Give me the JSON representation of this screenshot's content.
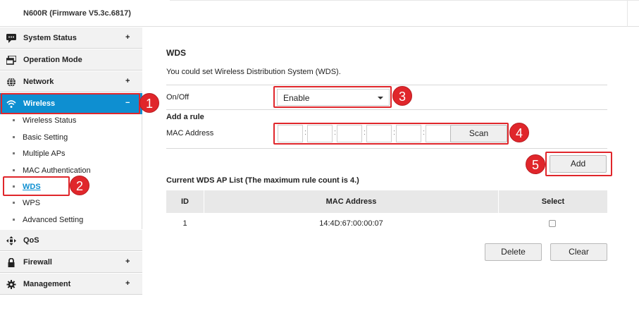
{
  "window": {
    "model_title": "N600R (Firmware V5.3c.6817)"
  },
  "sidebar": {
    "menu": [
      {
        "label": "System Status",
        "icon": "chat-bubble-icon",
        "toggle": "+"
      },
      {
        "label": "Operation Mode",
        "icon": "window-icon",
        "toggle": ""
      },
      {
        "label": "Network",
        "icon": "globe-icon",
        "toggle": "+"
      },
      {
        "label": "Wireless",
        "icon": "wifi-icon",
        "toggle": "−"
      },
      {
        "label": "QoS",
        "icon": "qos-icon",
        "toggle": ""
      },
      {
        "label": "Firewall",
        "icon": "lock-icon",
        "toggle": "+"
      },
      {
        "label": "Management",
        "icon": "gear-icon",
        "toggle": "+"
      }
    ],
    "wireless_sub": [
      {
        "label": "Wireless Status"
      },
      {
        "label": "Basic Setting"
      },
      {
        "label": "Multiple APs"
      },
      {
        "label": "MAC Authentication"
      },
      {
        "label": "WDS"
      },
      {
        "label": "WPS"
      },
      {
        "label": "Advanced Setting"
      }
    ]
  },
  "main": {
    "title": "WDS",
    "description": "You could set Wireless Distribution System (WDS).",
    "onoff_label": "On/Off",
    "onoff_value": "Enable",
    "add_rule_label": "Add a rule",
    "mac_label": "MAC Address",
    "mac_separator": ":",
    "scan_label": "Scan",
    "add_label": "Add",
    "list_title": "Current WDS AP List (The maximum rule count is 4.)",
    "columns": {
      "id": "ID",
      "mac": "MAC Address",
      "select": "Select"
    },
    "rows": [
      {
        "id": "1",
        "mac": "14:4D:67:00:00:07"
      }
    ],
    "delete_label": "Delete",
    "clear_label": "Clear"
  },
  "annotations": {
    "badges": [
      "1",
      "2",
      "3",
      "4",
      "5"
    ],
    "highlight_color": "#e0262b"
  },
  "colors": {
    "accent": "#0e8fd1"
  }
}
